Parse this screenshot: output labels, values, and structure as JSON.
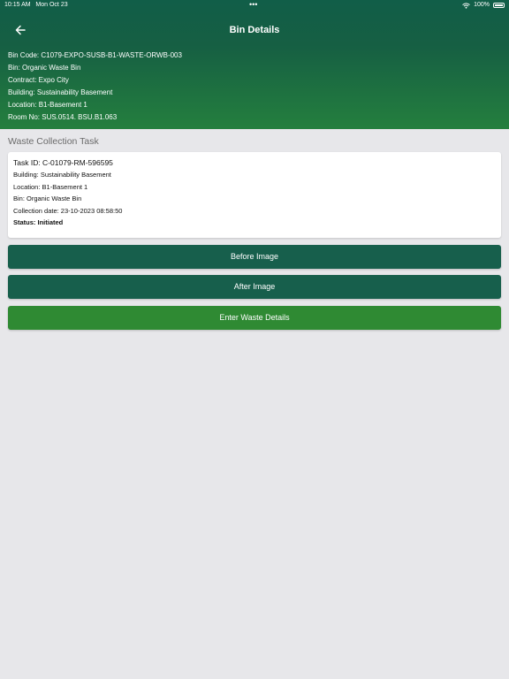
{
  "status_bar": {
    "time": "10:15 AM",
    "date": "Mon Oct 23",
    "dots": "•••",
    "battery": "100%"
  },
  "header": {
    "title": "Bin Details",
    "bin_code": "Bin Code: C1079-EXPO-SUSB-B1-WASTE-ORWB-003",
    "bin": "Bin: Organic Waste Bin",
    "contract": "Contract: Expo City",
    "building": "Building: Sustainability Basement",
    "location": "Location: B1-Basement 1",
    "room_no": "Room No: SUS.0514. BSU.B1.063"
  },
  "section": {
    "title": "Waste Collection Task"
  },
  "task_card": {
    "task_id": "Task ID: C-01079-RM-596595",
    "building": "Building: Sustainability Basement",
    "location": "Location: B1-Basement 1",
    "bin": "Bin: Organic Waste Bin",
    "collection_date": "Collection date: 23-10-2023 08:58:50",
    "status": "Status: Initiated"
  },
  "buttons": {
    "before_image": "Before Image",
    "after_image": "After Image",
    "enter_waste_details": "Enter Waste Details"
  },
  "colors": {
    "header_top": "#115e48",
    "header_bottom": "#247f3e",
    "button_dark": "#175f4c",
    "button_green": "#2f8a33",
    "background": "#e7e7ea"
  },
  "icons": {
    "back": "arrow-left-icon",
    "wifi": "wifi-icon",
    "battery": "battery-icon"
  }
}
